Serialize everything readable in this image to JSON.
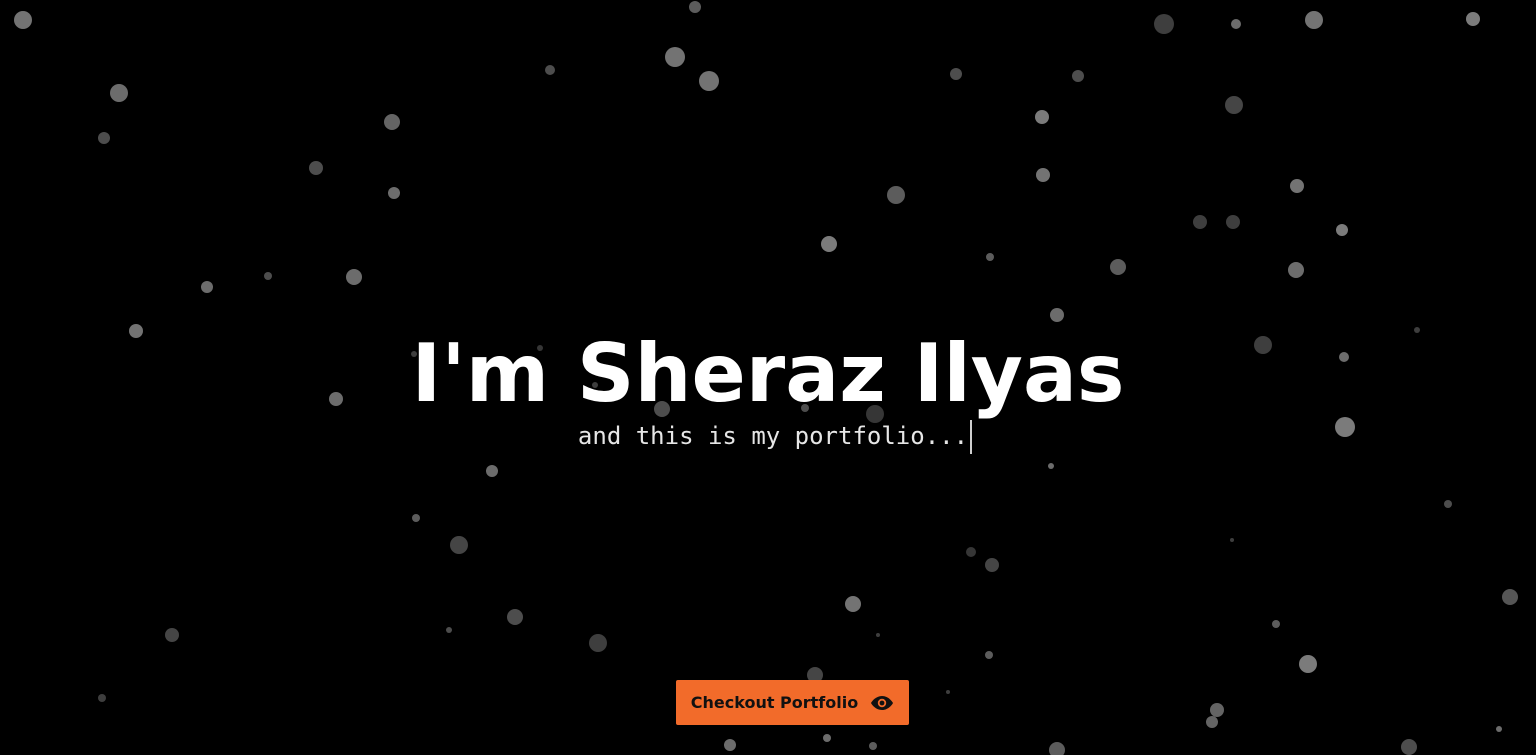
{
  "hero": {
    "title": "I'm Sheraz Ilyas",
    "subtitle": "and this is my portfolio..."
  },
  "cta": {
    "label": "Checkout Portfolio",
    "icon": "eye-icon"
  },
  "colors": {
    "background": "#000000",
    "title": "#ffffff",
    "subtitle": "#e6e6e6",
    "accent": "#f26b2a",
    "particle": "#9a9a9a"
  }
}
